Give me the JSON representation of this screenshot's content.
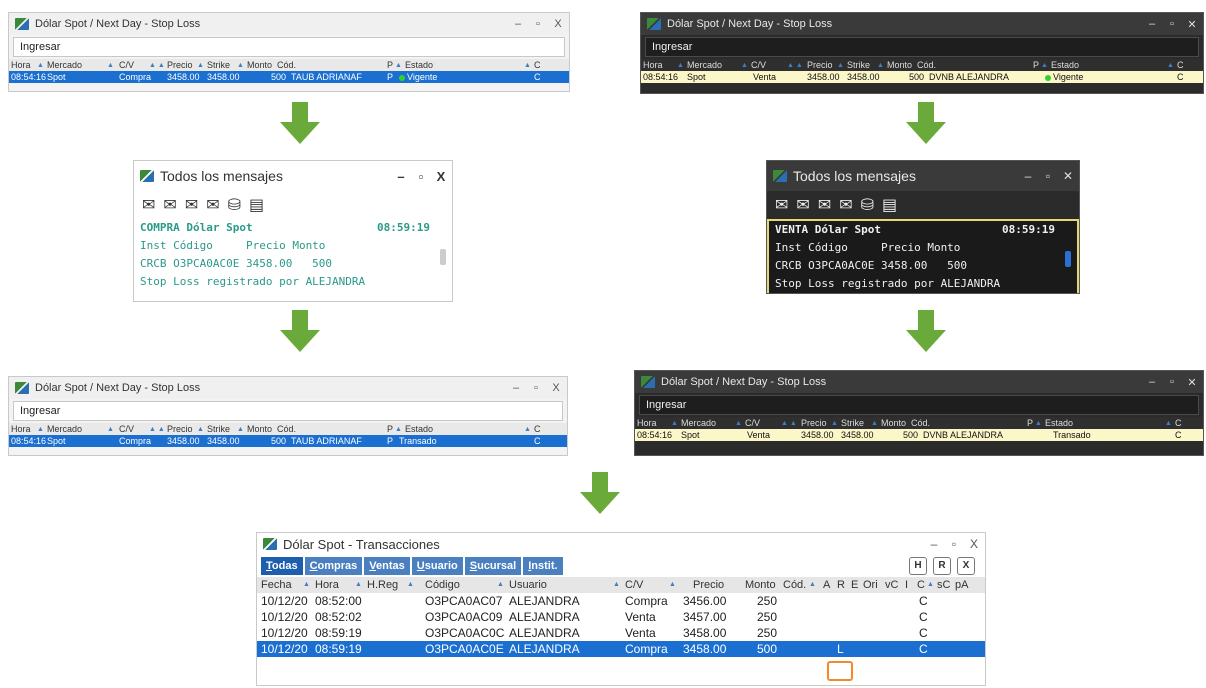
{
  "spot_window": {
    "title": "Dólar Spot / Next Day - Stop Loss",
    "ingresar": "Ingresar",
    "headers": [
      "Hora",
      "Mercado",
      "C/V",
      "Precio",
      "Strike",
      "Monto",
      "Cód.",
      "P",
      "Estado",
      "C"
    ],
    "row_compra": {
      "hora": "08:54:16",
      "mercado": "Spot",
      "cv": "Compra",
      "precio": "3458.00",
      "strike": "3458.00",
      "monto": "500",
      "cod": "TAUB ADRIANAF",
      "p": "P",
      "estado_vigente": "Vigente",
      "estado_transado": "Transado",
      "c": "C"
    },
    "row_venta": {
      "hora": "08:54:16",
      "mercado": "Spot",
      "cv": "Venta",
      "precio": "3458.00",
      "strike": "3458.00",
      "monto": "500",
      "cod": "DVNB ALEJANDRA",
      "estado_vigente": "Vigente",
      "estado_transado": "Transado",
      "c": "C"
    }
  },
  "messages": {
    "title": "Todos los mensajes",
    "compra_header": "COMPRA Dólar Spot",
    "venta_header": "VENTA Dólar Spot",
    "time": "08:59:19",
    "cols": "Inst Código     Precio Monto",
    "data_line": "CRCB O3PCA0AC0E 3458.00   500",
    "footer": "Stop Loss registrado por ALEJANDRA"
  },
  "transactions": {
    "title": "Dólar Spot - Transacciones",
    "tabs": [
      {
        "first": "T",
        "rest": "odas"
      },
      {
        "first": "C",
        "rest": "ompras"
      },
      {
        "first": "V",
        "rest": "entas"
      },
      {
        "first": "U",
        "rest": "suario"
      },
      {
        "first": "S",
        "rest": "ucursal"
      },
      {
        "first": "I",
        "rest": "nstit."
      }
    ],
    "icons": [
      "H",
      "R",
      "X"
    ],
    "headers": [
      "Fecha",
      "Hora",
      "H.Reg",
      "Código",
      "Usuario",
      "C/V",
      "Precio",
      "Monto",
      "Cód.",
      "A",
      "R",
      "E",
      "Ori",
      "vC",
      "I",
      "C",
      "sC",
      "pA"
    ],
    "rows": [
      {
        "fecha": "10/12/20",
        "hora": "08:52:00",
        "codigo": "O3PCA0AC07",
        "usuario": "ALEJANDRA",
        "cv": "Compra",
        "precio": "3456.00",
        "monto": "250",
        "r": "",
        "c": "C"
      },
      {
        "fecha": "10/12/20",
        "hora": "08:52:02",
        "codigo": "O3PCA0AC09",
        "usuario": "ALEJANDRA",
        "cv": "Venta",
        "precio": "3457.00",
        "monto": "250",
        "r": "",
        "c": "C"
      },
      {
        "fecha": "10/12/20",
        "hora": "08:59:19",
        "codigo": "O3PCA0AC0C",
        "usuario": "ALEJANDRA",
        "cv": "Venta",
        "precio": "3458.00",
        "monto": "250",
        "r": "",
        "c": "C"
      },
      {
        "fecha": "10/12/20",
        "hora": "08:59:19",
        "codigo": "O3PCA0AC0E",
        "usuario": "ALEJANDRA",
        "cv": "Compra",
        "precio": "3458.00",
        "monto": "500",
        "r": "L",
        "c": "C"
      }
    ]
  },
  "colors": {
    "arrow": "#6aaa3a",
    "selection": "#1a6fd1",
    "highlight": "#f08b2b"
  }
}
